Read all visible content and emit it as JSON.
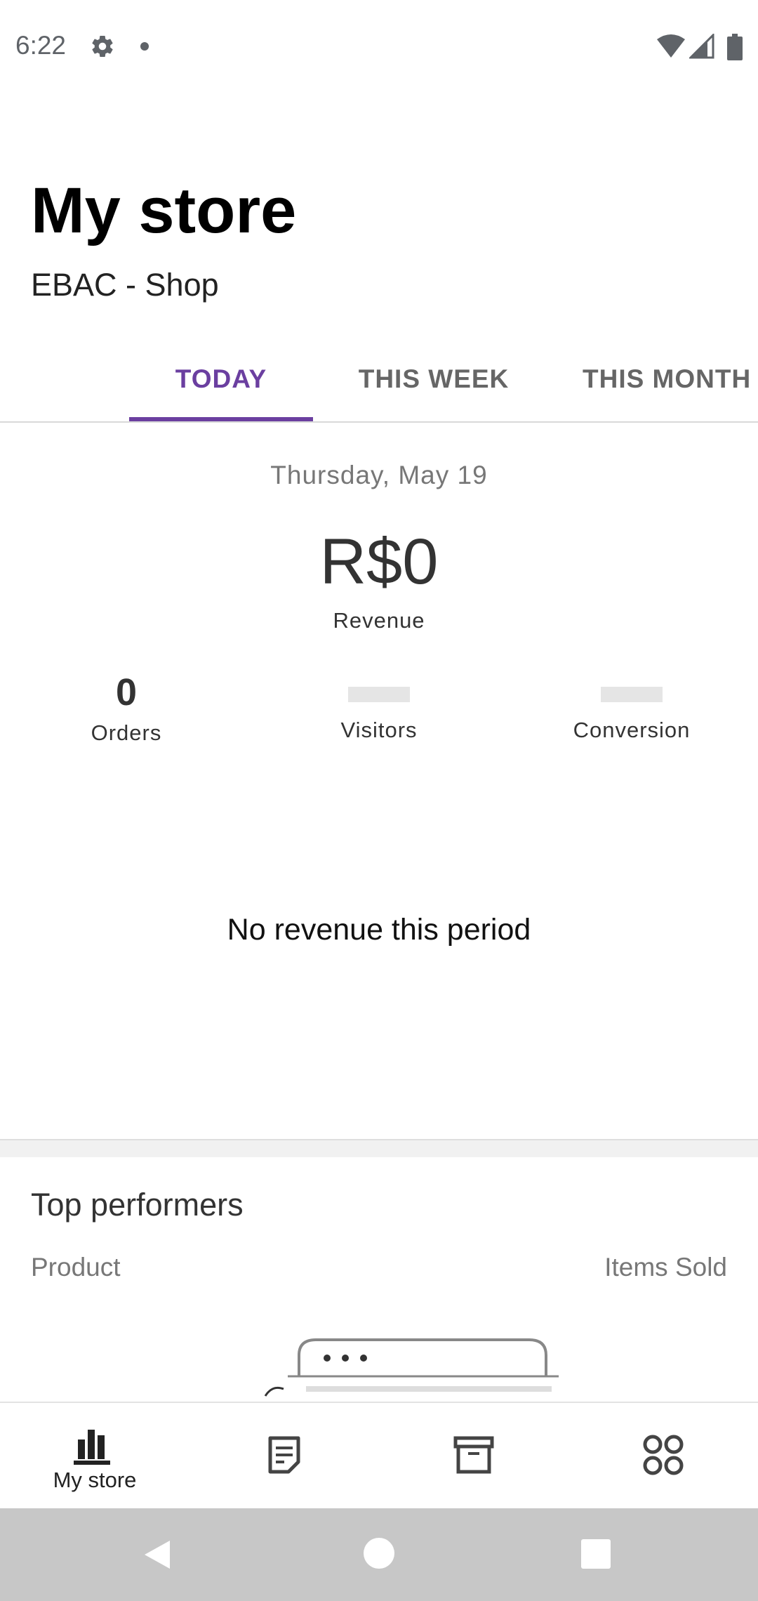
{
  "status_bar": {
    "time": "6:22",
    "icons": [
      "gear-icon",
      "notification-dot",
      "wifi-icon",
      "signal-icon",
      "battery-icon"
    ]
  },
  "header": {
    "title": "My store",
    "store_name": "EBAC - Shop"
  },
  "tabs": [
    {
      "label": "TODAY",
      "selected": true
    },
    {
      "label": "THIS WEEK",
      "selected": false
    },
    {
      "label": "THIS MONTH",
      "selected": false
    }
  ],
  "stats": {
    "date": "Thursday, May 19",
    "revenue_value": "R$0",
    "revenue_label": "Revenue",
    "orders_value": "0",
    "orders_label": "Orders",
    "visitors_label": "Visitors",
    "conversion_label": "Conversion",
    "empty_message": "No revenue this period"
  },
  "top_performers": {
    "title": "Top performers",
    "col_product": "Product",
    "col_items_sold": "Items Sold"
  },
  "bottom_nav": [
    {
      "label": "My store",
      "icon": "bar-chart-icon",
      "selected": true
    },
    {
      "label": "",
      "icon": "orders-icon"
    },
    {
      "label": "",
      "icon": "products-icon"
    },
    {
      "label": "",
      "icon": "more-grid-icon"
    }
  ],
  "colors": {
    "accent": "#6b3fa0",
    "system_nav_bg": "#c7c7c7"
  }
}
